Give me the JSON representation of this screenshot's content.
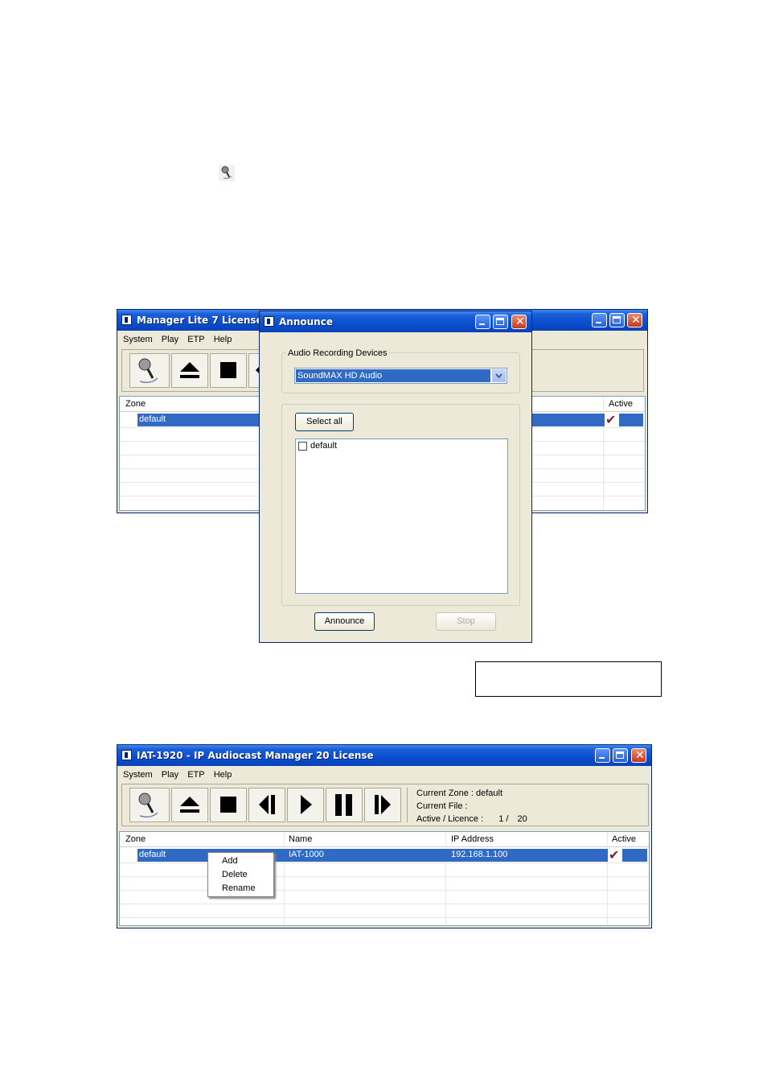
{
  "window1": {
    "title": "Manager Lite 7 License -",
    "menu": [
      "System",
      "Play",
      "ETP",
      "Help"
    ],
    "columns": {
      "zone": "Zone",
      "active": "Active"
    },
    "row": {
      "zone": "default"
    }
  },
  "dialog": {
    "title": "Announce",
    "group_label": "Audio Recording Devices",
    "device_selected": "SoundMAX HD Audio",
    "select_all": "Select all",
    "zone_item": "default",
    "announce": "Announce",
    "stop": "Stop"
  },
  "window2": {
    "title": "IAT-1920 - IP Audiocast Manager 20 License",
    "menu": [
      "System",
      "Play",
      "ETP",
      "Help"
    ],
    "status": {
      "current_zone_label": "Current Zone :",
      "current_zone": "default",
      "current_file_label": "Current File :",
      "active_licence_label": "Active / Licence :",
      "active": "1",
      "separator": "/",
      "licence": "20"
    },
    "columns": {
      "zone": "Zone",
      "name": "Name",
      "ip": "IP Address",
      "active": "Active"
    },
    "row": {
      "zone": "default",
      "name": "IAT-1000",
      "ip": "192.168.1.100"
    },
    "context_menu": [
      "Add",
      "Delete",
      "Rename"
    ]
  },
  "icons": {
    "announce": "microphone-icon",
    "eject": "eject-icon",
    "stop": "stop-icon",
    "prev": "previous-icon",
    "play": "play-icon",
    "pause": "pause-icon",
    "next": "next-icon"
  }
}
